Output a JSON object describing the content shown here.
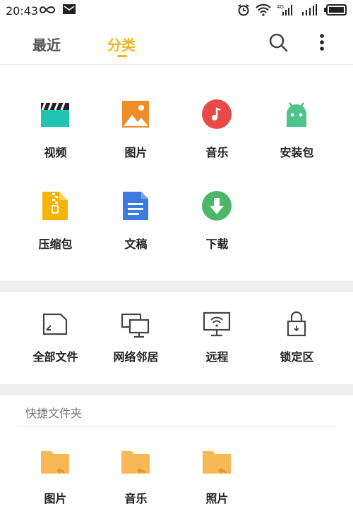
{
  "status_bar": {
    "time": "20:43",
    "icons": [
      "infinity-icon",
      "message-icon",
      "alarm-icon",
      "wifi-icon",
      "signal-4g-icon",
      "signal-icon",
      "battery-icon"
    ],
    "network_label": "4G"
  },
  "header": {
    "tabs": [
      {
        "label": "最近",
        "active": false
      },
      {
        "label": "分类",
        "active": true
      }
    ],
    "accent_color": "#f2b320"
  },
  "categories": [
    {
      "label": "视频",
      "icon": "video-clapper-icon",
      "color": "#1fc4b3"
    },
    {
      "label": "图片",
      "icon": "image-icon",
      "color": "#f08d2a"
    },
    {
      "label": "音乐",
      "icon": "music-icon",
      "color": "#e94a47"
    },
    {
      "label": "安装包",
      "icon": "android-icon",
      "color": "#4ec48a"
    },
    {
      "label": "压缩包",
      "icon": "zip-icon",
      "color": "#f5b400"
    },
    {
      "label": "文稿",
      "icon": "document-icon",
      "color": "#3e7be0"
    },
    {
      "label": "下载",
      "icon": "download-icon",
      "color": "#4db669"
    }
  ],
  "locations": [
    {
      "label": "全部文件",
      "icon": "all-files-icon"
    },
    {
      "label": "网络邻居",
      "icon": "network-neighbors-icon"
    },
    {
      "label": "远程",
      "icon": "remote-icon"
    },
    {
      "label": "锁定区",
      "icon": "lock-icon"
    }
  ],
  "quick_folders": {
    "title": "快捷文件夹",
    "items": [
      {
        "label": "图片",
        "icon": "folder-shortcut-icon"
      },
      {
        "label": "音乐",
        "icon": "folder-shortcut-icon"
      },
      {
        "label": "照片",
        "icon": "folder-shortcut-icon"
      }
    ]
  }
}
